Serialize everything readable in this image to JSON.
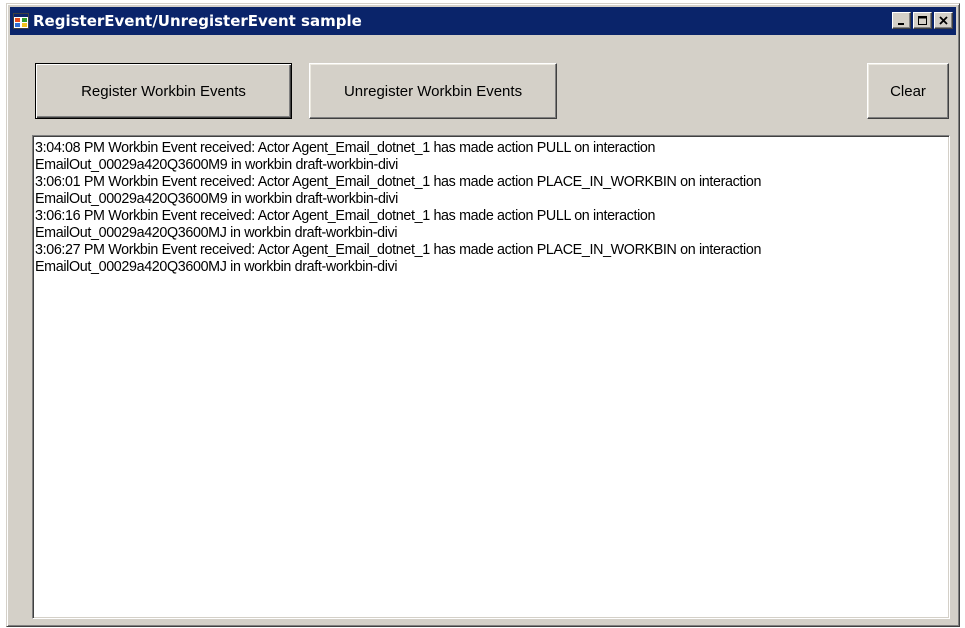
{
  "window": {
    "title": "RegisterEvent/UnregisterEvent sample",
    "icon": "app-window-icon",
    "controls": [
      "minimize",
      "maximize",
      "close"
    ]
  },
  "toolbar": {
    "register_label": "Register Workbin Events",
    "unregister_label": "Unregister Workbin Events",
    "clear_label": "Clear"
  },
  "log": {
    "lines": [
      "3:04:08 PM Workbin Event received: Actor Agent_Email_dotnet_1 has made action PULL on interaction",
      "EmailOut_00029a420Q3600M9 in workbin draft-workbin-divi",
      "3:06:01 PM Workbin Event received: Actor Agent_Email_dotnet_1 has made action PLACE_IN_WORKBIN on interaction",
      "EmailOut_00029a420Q3600M9 in workbin draft-workbin-divi",
      "3:06:16 PM Workbin Event received: Actor Agent_Email_dotnet_1 has made action PULL on interaction",
      "EmailOut_00029a420Q3600MJ in workbin draft-workbin-divi",
      "3:06:27 PM Workbin Event received: Actor Agent_Email_dotnet_1 has made action PLACE_IN_WORKBIN on interaction",
      "EmailOut_00029a420Q3600MJ in workbin draft-workbin-divi"
    ]
  },
  "colors": {
    "titlebar": "#0a246a",
    "face": "#d4d0c8",
    "log_background": "#ffffff"
  }
}
